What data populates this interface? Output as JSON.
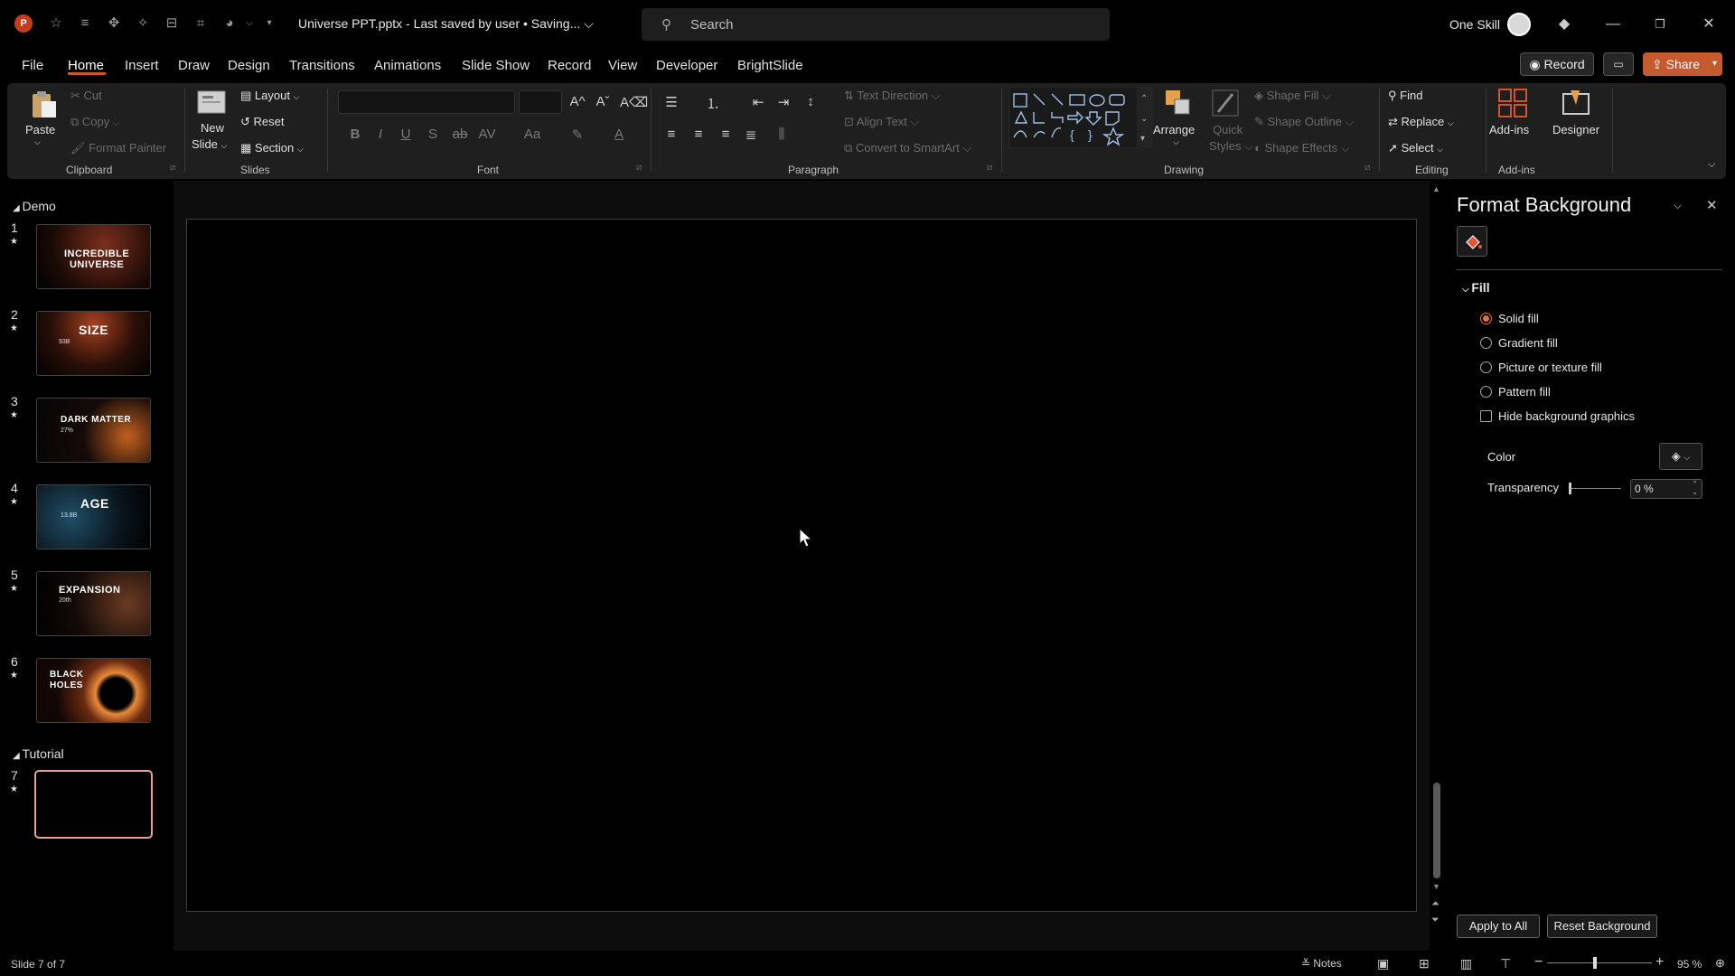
{
  "titlebar": {
    "doc_title": "Universe PPT.pptx  -  Last saved by user • Saving...  ⌵",
    "search_placeholder": "Search",
    "user_name": "One Skill"
  },
  "menu": {
    "tabs": [
      "File",
      "Home",
      "Insert",
      "Draw",
      "Design",
      "Transitions",
      "Animations",
      "Slide Show",
      "Record",
      "View",
      "Developer",
      "BrightSlide"
    ],
    "record_label": "Record",
    "share_label": "Share"
  },
  "ribbon": {
    "clipboard": {
      "paste": "Paste",
      "cut": "Cut",
      "copy": "Copy",
      "format_painter": "Format Painter",
      "label": "Clipboard"
    },
    "slides": {
      "new_slide_1": "New",
      "new_slide_2": "Slide",
      "layout": "Layout",
      "reset": "Reset",
      "section": "Section",
      "label": "Slides"
    },
    "font": {
      "label": "Font",
      "bold": "B",
      "italic": "I",
      "underline": "U",
      "shadow": "S",
      "strike": "ab",
      "spacing": "AV",
      "case": "Aa",
      "grow": "A^",
      "shrink": "Aˇ"
    },
    "paragraph": {
      "text_direction": "Text Direction",
      "align_text": "Align Text",
      "smartart": "Convert to SmartArt",
      "label": "Paragraph"
    },
    "drawing": {
      "arrange": "Arrange",
      "quick_1": "Quick",
      "quick_2": "Styles",
      "shape_fill": "Shape Fill",
      "shape_outline": "Shape Outline",
      "shape_effects": "Shape Effects",
      "label": "Drawing"
    },
    "editing": {
      "find": "Find",
      "replace": "Replace",
      "select": "Select",
      "label": "Editing"
    },
    "addins": {
      "addins": "Add-ins",
      "designer": "Designer",
      "label": "Add-ins"
    }
  },
  "thumbnails": {
    "sections": [
      "Demo",
      "Tutorial"
    ],
    "slides": [
      {
        "num": "1",
        "title": "INCREDIBLE\nUNIVERSE",
        "sub": ""
      },
      {
        "num": "2",
        "title": "SIZE",
        "sub": "93B"
      },
      {
        "num": "3",
        "title": "DARK MATTER",
        "sub": "27%"
      },
      {
        "num": "4",
        "title": "AGE",
        "sub": "13.8B"
      },
      {
        "num": "5",
        "title": "EXPANSION",
        "sub": "20th"
      },
      {
        "num": "6",
        "title": "BLACK\nHOLES",
        "sub": ""
      },
      {
        "num": "7",
        "title": "",
        "sub": ""
      }
    ]
  },
  "format_pane": {
    "title": "Format Background",
    "section": "Fill",
    "options": [
      "Solid fill",
      "Gradient fill",
      "Picture or texture fill",
      "Pattern fill"
    ],
    "selected_option": "Solid fill",
    "hide_graphics": "Hide background graphics",
    "color_label": "Color",
    "transparency_label": "Transparency",
    "transparency_value": "0 %",
    "apply_all": "Apply to All",
    "reset_bg": "Reset Background"
  },
  "status": {
    "slide_counter": "Slide 7 of 7",
    "notes": "Notes",
    "zoom": "95 %"
  },
  "colors": {
    "accent": "#d35230",
    "selected_thumb": "#e8a090"
  }
}
